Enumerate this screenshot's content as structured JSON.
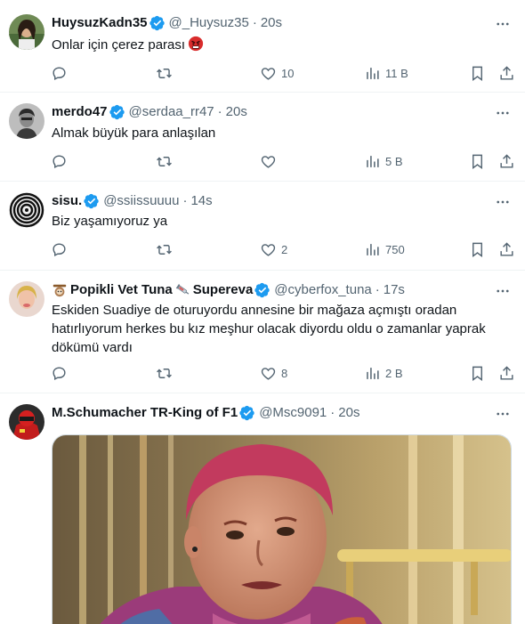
{
  "tweets": [
    {
      "name": "HuysuzKadn35",
      "handle": "@_Huysuz35",
      "time": "20s",
      "text": "Onlar için çerez parası",
      "inline_emoji": "angry-face-emoji",
      "replies": "",
      "reposts": "",
      "likes": "10",
      "views": "11 B"
    },
    {
      "name": "merdo47",
      "handle": "@serdaa_rr47",
      "time": "20s",
      "text": "Almak büyük para anlaşılan",
      "replies": "",
      "reposts": "",
      "likes": "",
      "views": "5 B"
    },
    {
      "name": "sisu.",
      "handle": "@ssiissuuuu",
      "time": "14s",
      "text": "Biz yaşamıyoruz ya",
      "replies": "",
      "reposts": "",
      "likes": "2",
      "views": "750"
    },
    {
      "name": "Popikli Vet Tuna",
      "name_suffix": "Supereva",
      "handle": "@cyberfox_tuna",
      "time": "17s",
      "text": "Eskiden Suadiye de oturuyordu annesine bir mağaza açmıştı oradan hatırlıyorum herkes bu kız meşhur olacak diyordu oldu o zamanlar yaprak dökümü vardı",
      "replies": "",
      "reposts": "",
      "likes": "8",
      "views": "2 B"
    },
    {
      "name": "M.Schumacher TR-King of F1",
      "handle": "@Msc9091",
      "time": "20s",
      "media_icon": "photo-of-man-with-red-hair"
    }
  ],
  "separator": "·",
  "colors": {
    "text_primary": "#0f1419",
    "text_secondary": "#536471",
    "verified_blue": "#1d9bf0",
    "divider": "#eff3f4"
  },
  "icons": [
    "reply-icon",
    "repost-icon",
    "like-icon",
    "views-icon",
    "bookmark-icon",
    "share-icon",
    "more-icon",
    "verified-badge-icon"
  ]
}
